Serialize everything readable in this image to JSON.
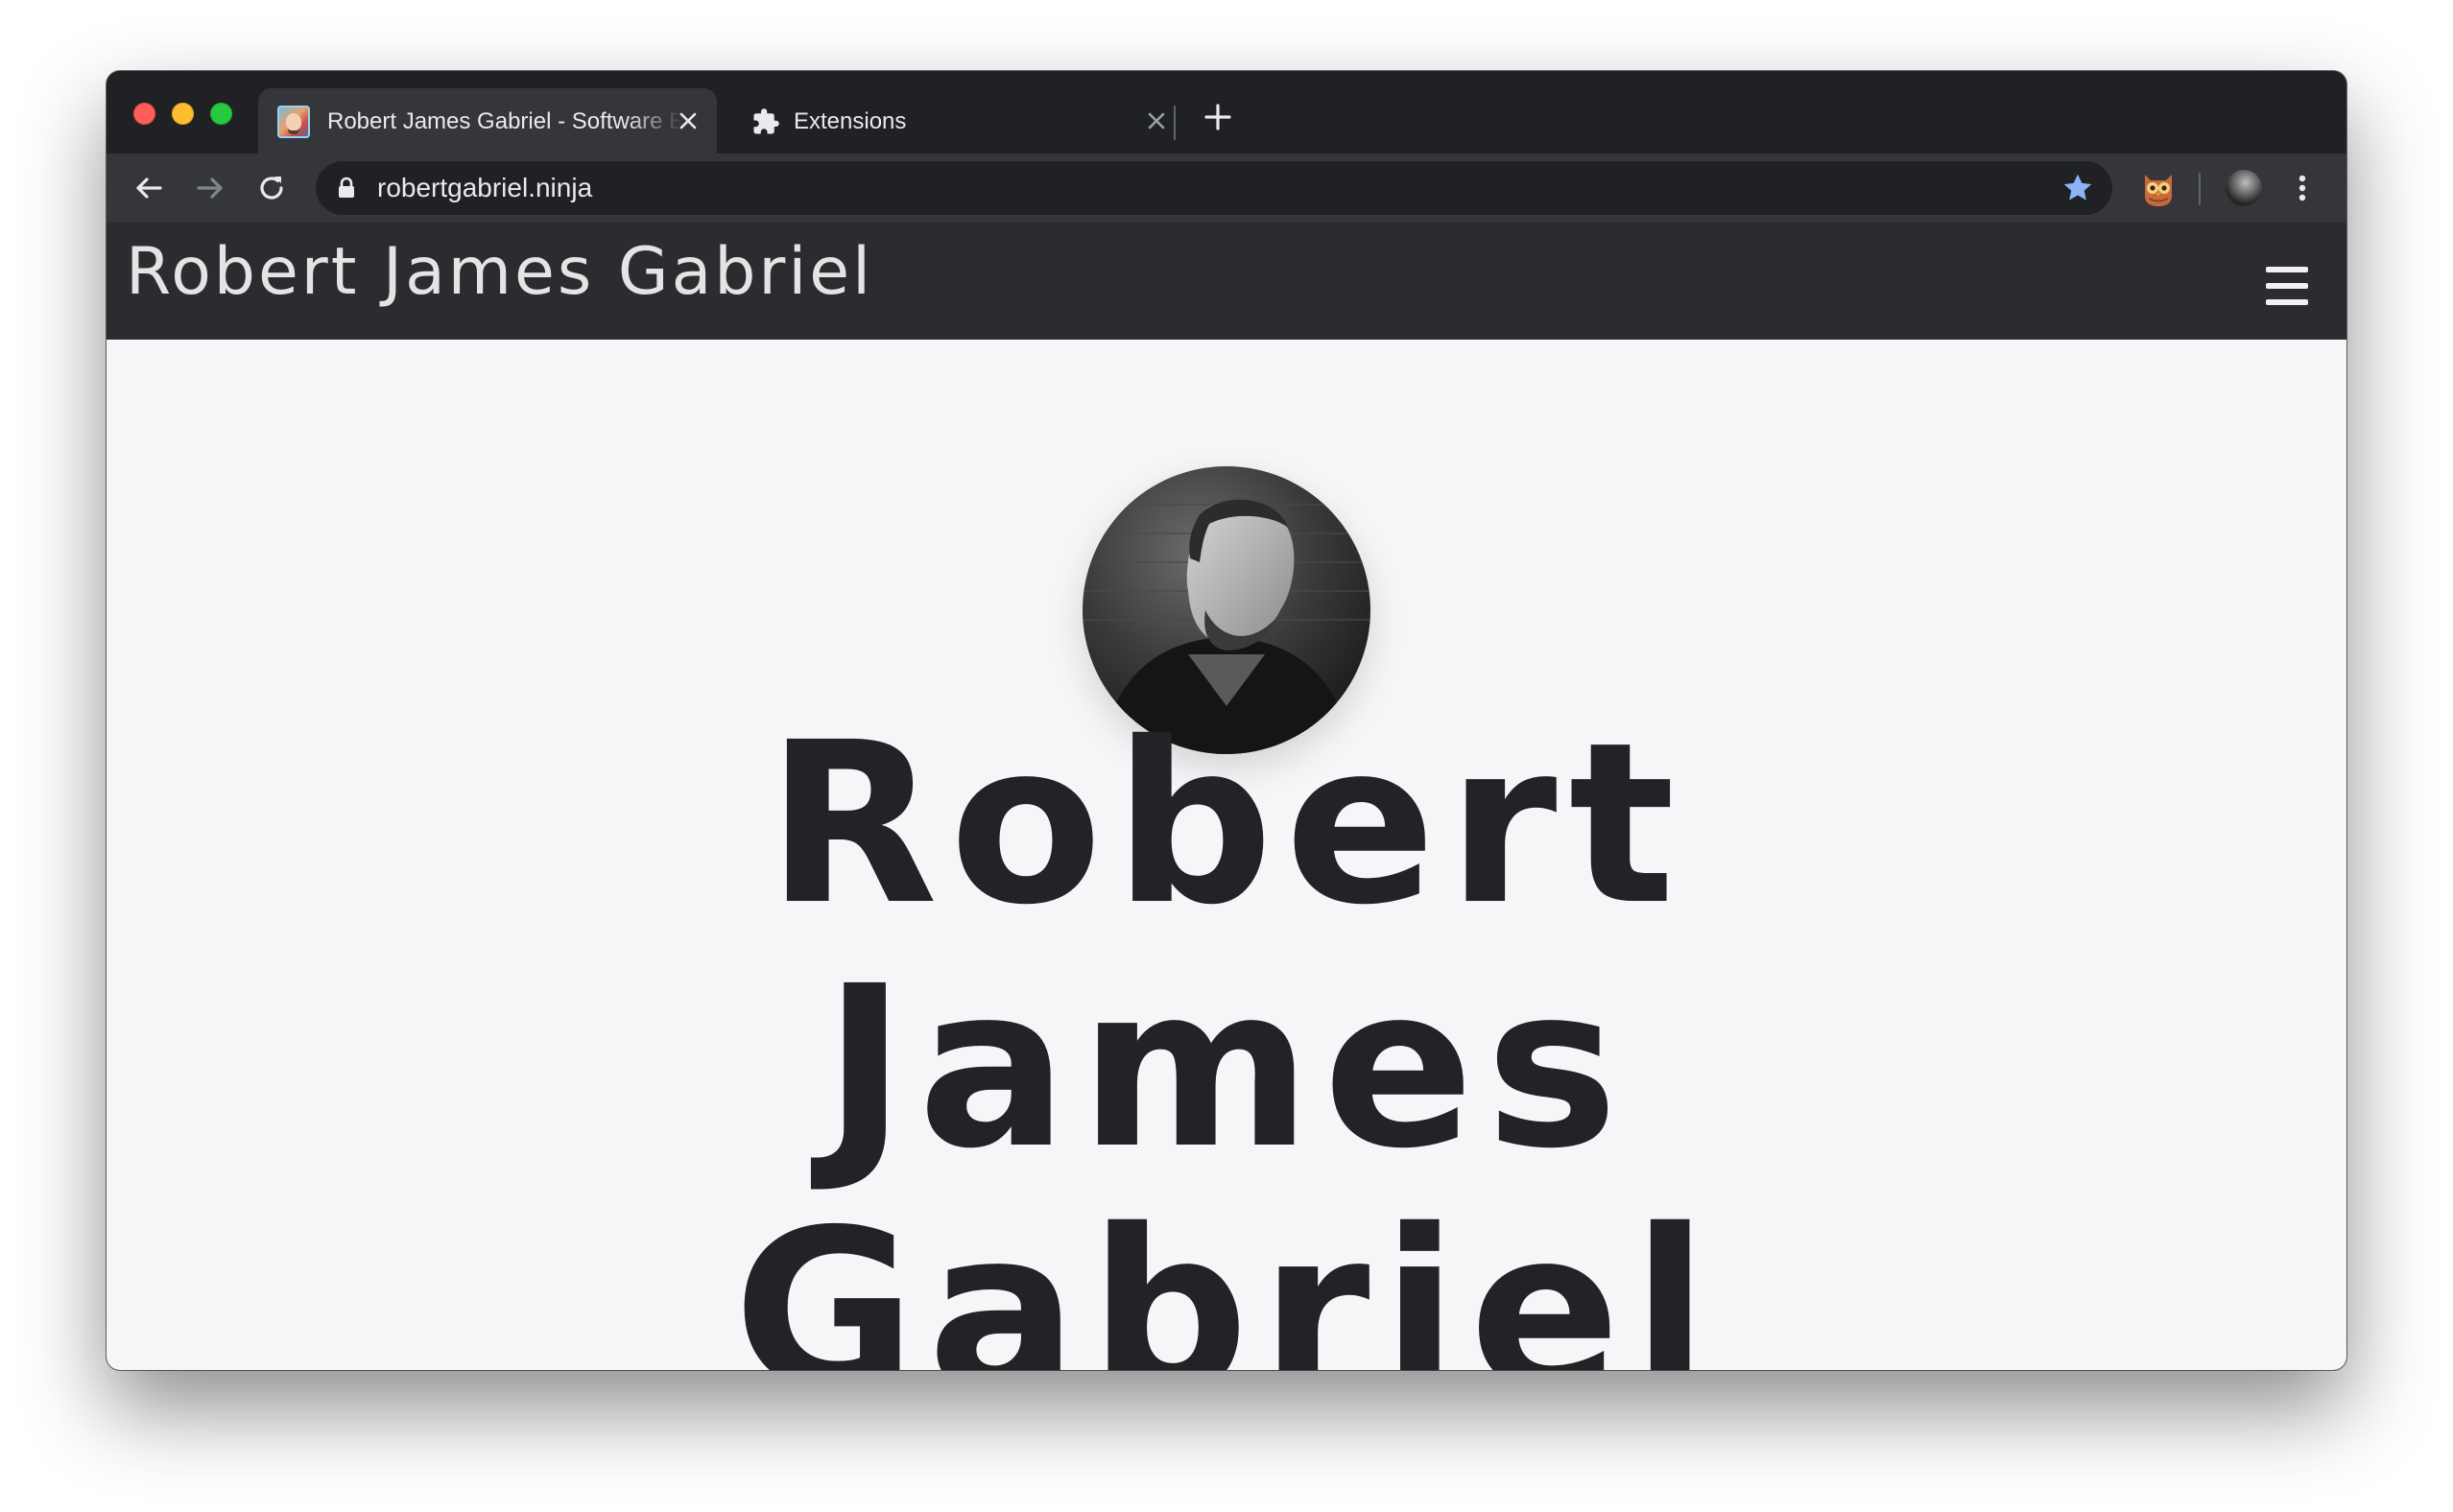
{
  "browser": {
    "tabs": [
      {
        "title": "Robert James Gabriel - Software Engineer",
        "favicon": "avatar-favicon",
        "active": true
      },
      {
        "title": "Extensions",
        "favicon": "puzzle-icon",
        "active": false
      }
    ],
    "address_bar": {
      "url": "robertgabriel.ninja"
    }
  },
  "site": {
    "brand": "Robert James Gabriel",
    "hero": {
      "name_lines": [
        "Robert",
        "James",
        "Gabriel"
      ]
    }
  },
  "colors": {
    "tabstrip_bg": "#202124",
    "toolbar_bg": "#35363a",
    "site_header_bg": "#2b2c2f",
    "page_bg": "#f5f6f8",
    "bookmark_star": "#8ab4f8",
    "hero_text": "#222326"
  }
}
